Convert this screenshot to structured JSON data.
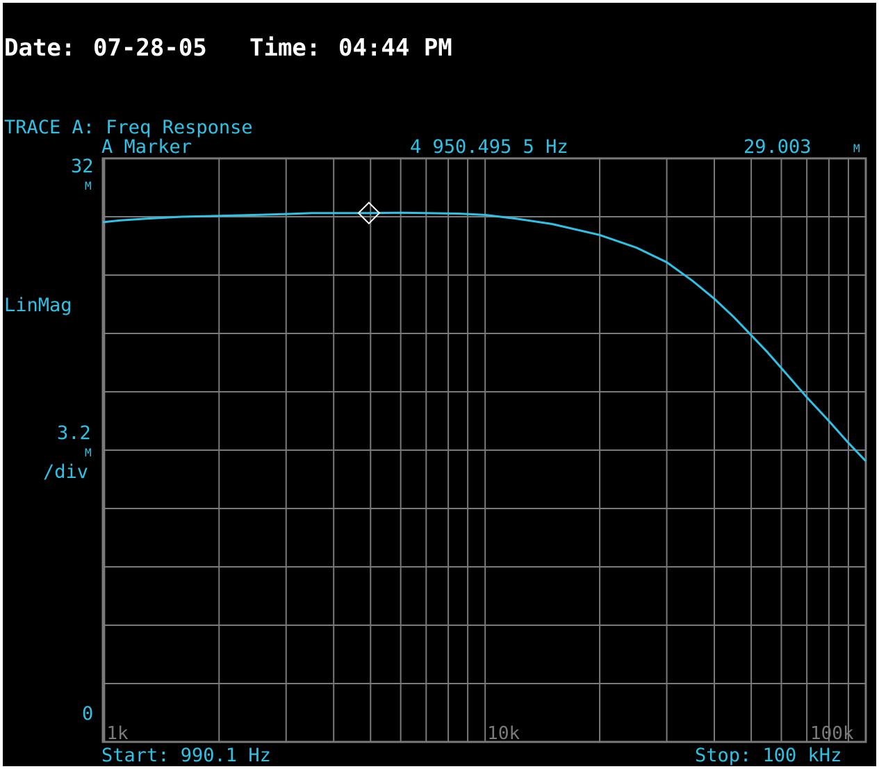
{
  "header": {
    "date_label": "Date:",
    "date_value": "07-28-05",
    "time_label": "Time:",
    "time_value": "04:44 PM"
  },
  "trace": {
    "name": "TRACE A: Freq Response",
    "marker_label": "A Marker",
    "marker_frequency": "4 950.495 5 Hz",
    "marker_value": "29.003",
    "marker_unit": "M"
  },
  "scale": {
    "top_value": "32",
    "top_unit": "M",
    "format": "LinMag",
    "per_div_value": "3.2",
    "per_div_unit": "M",
    "per_div_suffix": "/div",
    "bottom_value": "0"
  },
  "sweep": {
    "start": "Start: 990.1 Hz",
    "stop": "Stop: 100 kHz"
  },
  "colors": {
    "background": "#000000",
    "grid": "#7a7a7a",
    "trace": "#2ec3e6",
    "header_text": "#ffffff",
    "marker": "#ffffff"
  },
  "chart_data": {
    "type": "line",
    "x_scale": "log",
    "xlim": [
      990.1,
      100000
    ],
    "ylim": [
      0,
      32
    ],
    "y_units": "M",
    "grid": true,
    "x_tick_labels": [
      {
        "label": "1k",
        "value": 1000
      },
      {
        "label": "10k",
        "value": 10000
      },
      {
        "label": "100k",
        "value": 100000
      }
    ],
    "series": [
      {
        "x": [
          990.1,
          1100,
          1300,
          1600,
          2000,
          2500,
          3000,
          3500,
          4000,
          4950,
          6000,
          7000,
          8500,
          10000,
          12000,
          15000,
          20000,
          25000,
          30000,
          35000,
          40000,
          45000,
          50000,
          55000,
          60000,
          70000,
          80000,
          90000,
          100000
        ],
        "y": [
          28.5,
          28.6,
          28.7,
          28.8,
          28.85,
          28.9,
          28.95,
          29.0,
          29.0,
          29.003,
          29.02,
          29.0,
          28.97,
          28.9,
          28.7,
          28.4,
          27.8,
          27.1,
          26.3,
          25.3,
          24.3,
          23.3,
          22.3,
          21.4,
          20.5,
          18.9,
          17.6,
          16.4,
          15.4
        ]
      }
    ],
    "marker": {
      "x": 4950.4955,
      "y": 29.003
    }
  }
}
